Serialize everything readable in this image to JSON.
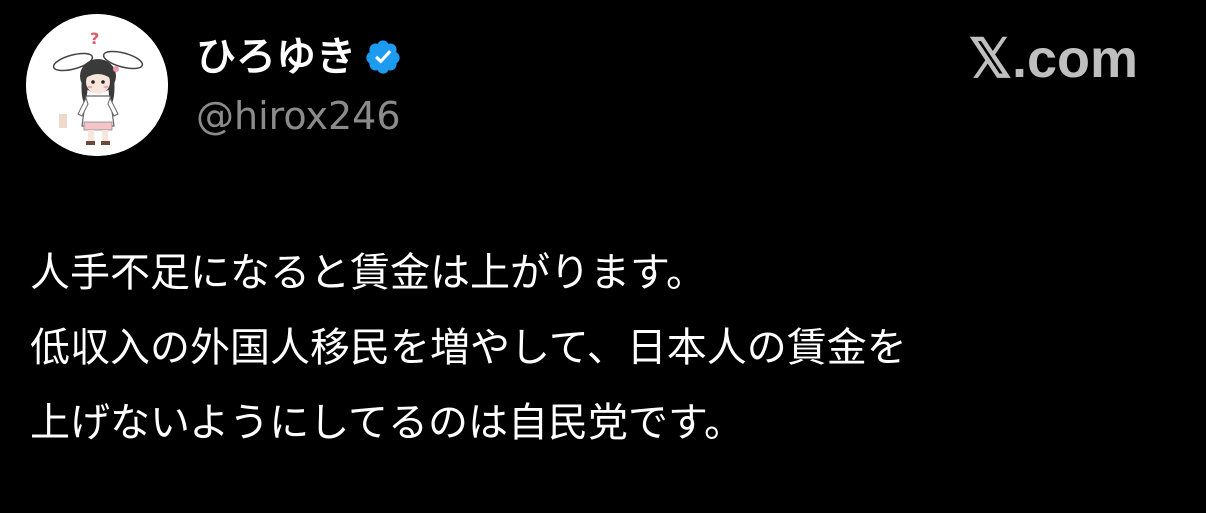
{
  "author": {
    "display_name": "ひろゆき",
    "handle": "@hirox246",
    "verified_icon": "verified-badge-icon",
    "avatar_icon": "avatar-bunny-character"
  },
  "brand": {
    "label": "𝕏.com"
  },
  "tweet": {
    "lines": [
      "人手不足になると賃金は上がります。",
      "低収入の外国人移民を増やして、日本人の賃金を",
      "上げないようにしてるのは自民党です。"
    ]
  },
  "colors": {
    "background": "#000000",
    "text": "#ffffff",
    "handle": "#8b8b8b",
    "brand": "#bfbfbf",
    "verified": "#1d9bf0"
  }
}
